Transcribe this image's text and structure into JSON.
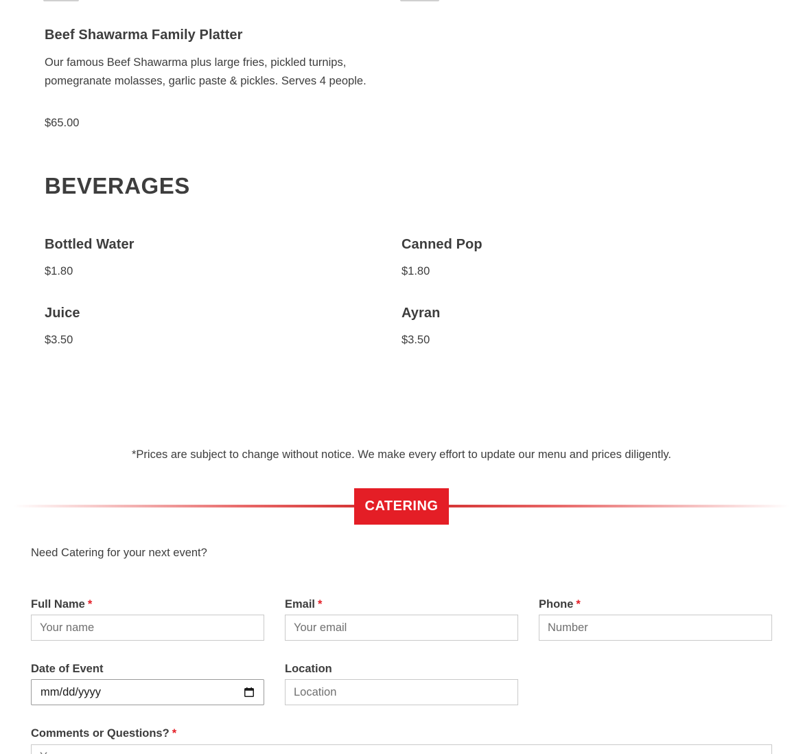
{
  "menu": {
    "featured_item": {
      "title": "Beef Shawarma Family Platter",
      "description": "Our famous Beef Shawarma plus large fries, pickled turnips, pomegranate molasses, garlic paste & pickles. Serves 4 people.",
      "price": "$65.00"
    },
    "beverages": {
      "heading": "BEVERAGES",
      "items": [
        {
          "name": "Bottled Water",
          "price": "$1.80"
        },
        {
          "name": "Canned Pop",
          "price": "$1.80"
        },
        {
          "name": "Juice",
          "price": "$3.50"
        },
        {
          "name": "Ayran",
          "price": "$3.50"
        }
      ]
    },
    "notice": "*Prices are subject to change without notice. We make every effort to update our menu and prices diligently."
  },
  "catering": {
    "badge": "CATERING",
    "intro": "Need Catering for your next event?",
    "form": {
      "full_name": {
        "label": "Full Name",
        "placeholder": "Your name",
        "required": "*"
      },
      "email": {
        "label": "Email",
        "placeholder": "Your email",
        "required": "*"
      },
      "phone": {
        "label": "Phone",
        "placeholder": "Number",
        "required": "*"
      },
      "date": {
        "label": "Date of Event",
        "value": "mm/dd/yyyy"
      },
      "location": {
        "label": "Location",
        "placeholder": "Location"
      },
      "comments": {
        "label": "Comments or Questions?",
        "required": "*",
        "placeholder": "Y"
      }
    }
  },
  "colors": {
    "accent": "#e41e26",
    "text": "#3d3d3d"
  }
}
